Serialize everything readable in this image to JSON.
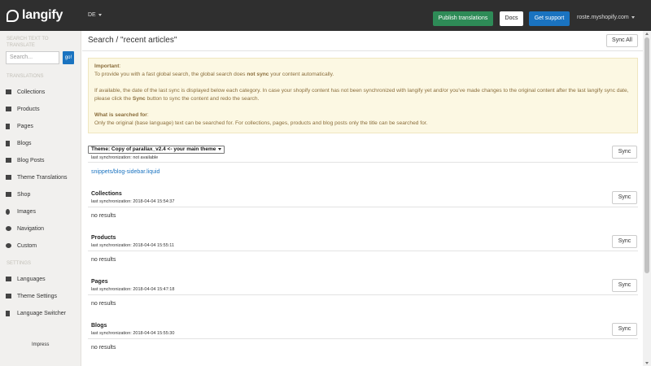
{
  "topbar": {
    "logo": "langify",
    "language": "DE",
    "publish_label": "Publish translations",
    "docs_label": "Docs",
    "support_label": "Get support",
    "shop": "roste.myshopify.com"
  },
  "sidebar": {
    "search_heading": "SEARCH TEXT TO TRANSLATE",
    "search_placeholder": "Search...",
    "go_label": "go!",
    "translations_heading": "TRANSLATIONS",
    "translation_items": [
      {
        "label": "Collections",
        "icon": "collections-icon"
      },
      {
        "label": "Products",
        "icon": "products-icon"
      },
      {
        "label": "Pages",
        "icon": "pages-icon"
      },
      {
        "label": "Blogs",
        "icon": "blogs-icon"
      },
      {
        "label": "Blog Posts",
        "icon": "blog-posts-icon"
      },
      {
        "label": "Theme Translations",
        "icon": "image-icon"
      },
      {
        "label": "Shop",
        "icon": "home-icon"
      },
      {
        "label": "Images",
        "icon": "drop-icon"
      },
      {
        "label": "Navigation",
        "icon": "link-icon"
      },
      {
        "label": "Custom",
        "icon": "custom-icon"
      }
    ],
    "settings_heading": "SETTINGS",
    "settings_items": [
      {
        "label": "Languages",
        "icon": "chat-icon"
      },
      {
        "label": "Theme Settings",
        "icon": "image-icon"
      },
      {
        "label": "Language Switcher",
        "icon": "pencil-icon"
      }
    ],
    "impress": "Impress"
  },
  "main": {
    "title": "Search / \"recent articles\"",
    "sync_all_label": "Sync All",
    "notice": {
      "important_label": "Important",
      "line1_pre": "To provide you with a fast global search, the global search does ",
      "line1_bold": "not sync",
      "line1_post": " your content automatically.",
      "line2_pre": "If available, the date of the last sync is displayed below each category. In case your shopify content has not been synchronized with langify yet and/or you've made changes to the original content after the last langify sync date, please click the ",
      "line2_bold": "Sync",
      "line2_post": " button to sync the content and redo the search.",
      "what_label": "What is searched for",
      "line3": "Only the original (base language) text can be searched for. For collections, pages, products and blog posts only the title can be searched for."
    },
    "theme": {
      "select_value": "Theme: Copy of parallax_v2.4 <- your main theme",
      "last_sync": "last synchronization: not available",
      "sync_label": "Sync",
      "result_link": "snippets/blog-sidebar.liquid"
    },
    "sections": [
      {
        "title": "Collections",
        "last_sync": "last synchronization: 2018-04-04 15:54:37",
        "sync_label": "Sync",
        "result": "no results"
      },
      {
        "title": "Products",
        "last_sync": "last synchronization: 2018-04-04 15:55:11",
        "sync_label": "Sync",
        "result": "no results"
      },
      {
        "title": "Pages",
        "last_sync": "last synchronization: 2018-04-04 15:47:18",
        "sync_label": "Sync",
        "result": "no results"
      },
      {
        "title": "Blogs",
        "last_sync": "last synchronization: 2018-04-04 15:55:30",
        "sync_label": "Sync",
        "result": "no results"
      }
    ]
  },
  "colors": {
    "topbar": "#2f2f2f",
    "publish": "#2e8b57",
    "support": "#1a73c0",
    "notice_bg": "#fcf8e3",
    "notice_text": "#8a6d3b"
  }
}
